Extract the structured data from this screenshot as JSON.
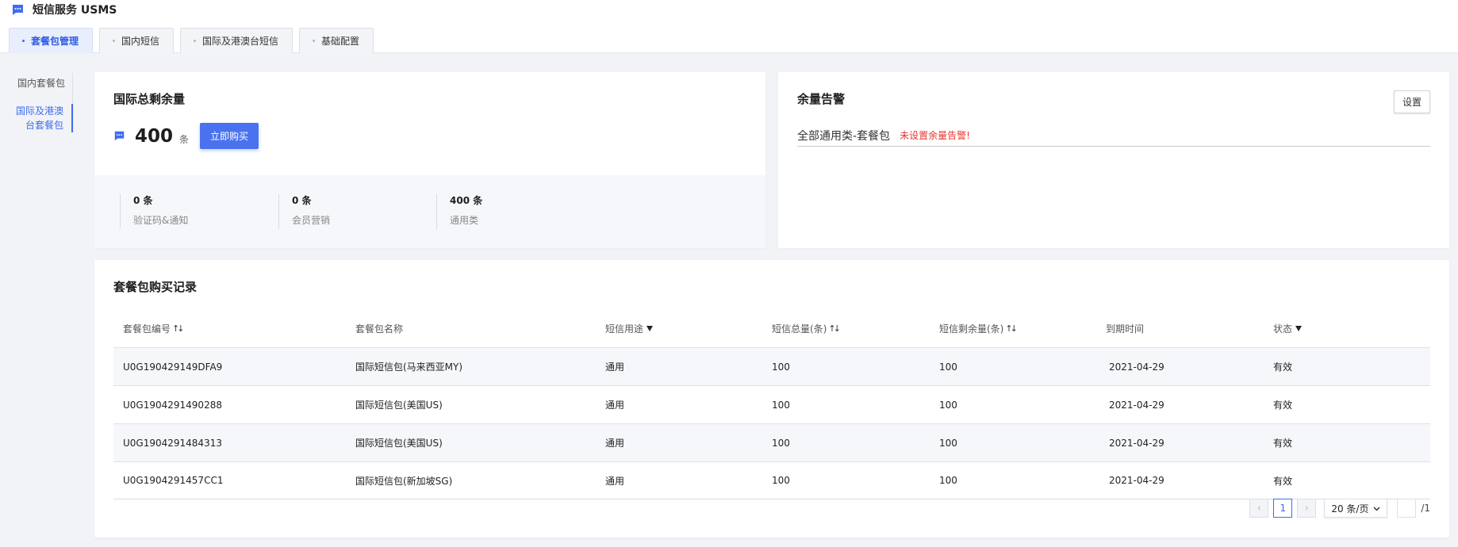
{
  "app": {
    "title": "短信服务 USMS",
    "icon": "message-icon",
    "accent": "#3e6cf0"
  },
  "tabs": [
    {
      "label": "套餐包管理",
      "active": true
    },
    {
      "label": "国内短信",
      "active": false
    },
    {
      "label": "国际及港澳台短信",
      "active": false
    },
    {
      "label": "基础配置",
      "active": false
    }
  ],
  "sidenav": [
    {
      "label": "国内套餐包",
      "active": false
    },
    {
      "label": "国际及港澳台套餐包",
      "line1": "国际及港澳",
      "line2": "台套餐包",
      "active": true
    }
  ],
  "balance": {
    "title": "国际总剩余量",
    "value": "400",
    "unit": "条",
    "buy_label": "立即购买",
    "stats": [
      {
        "value": "0 条",
        "label": "验证码&通知"
      },
      {
        "value": "0 条",
        "label": "会员营销"
      },
      {
        "value": "400 条",
        "label": "通用类"
      }
    ]
  },
  "alert": {
    "title": "余量告警",
    "settings_label": "设置",
    "package_name": "全部通用类-套餐包",
    "warning": "未设置余量告警!",
    "warning_color": "#e5362c"
  },
  "records": {
    "title": "套餐包购买记录",
    "columns": [
      "套餐包编号",
      "套餐包名称",
      "短信用途",
      "短信总量(条)",
      "短信剩余量(条)",
      "到期时间",
      "状态"
    ],
    "rows": [
      [
        "U0G190429149DFA9",
        "国际短信包(马来西亚MY)",
        "通用",
        "100",
        "100",
        "2021-04-29",
        "有效"
      ],
      [
        "U0G1904291490288",
        "国际短信包(美国US)",
        "通用",
        "100",
        "100",
        "2021-04-29",
        "有效"
      ],
      [
        "U0G1904291484313",
        "国际短信包(美国US)",
        "通用",
        "100",
        "100",
        "2021-04-29",
        "有效"
      ],
      [
        "U0G1904291457CC1",
        "国际短信包(新加坡SG)",
        "通用",
        "100",
        "100",
        "2021-04-29",
        "有效"
      ]
    ]
  },
  "pagination": {
    "current_page": "1",
    "page_size": "20 条/页",
    "total_pages": "/1"
  }
}
